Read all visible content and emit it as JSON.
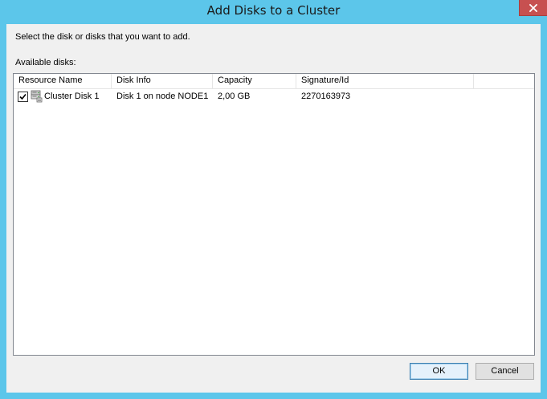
{
  "window": {
    "title": "Add Disks to a Cluster",
    "close_icon": "close-icon"
  },
  "dialog": {
    "instruction": "Select the disk or disks that you want to add.",
    "available_label": "Available disks:"
  },
  "table": {
    "columns": [
      "Resource Name",
      "Disk Info",
      "Capacity",
      "Signature/Id"
    ],
    "rows": [
      {
        "checked": true,
        "icon": "cluster-disk-icon",
        "resource_name": "Cluster Disk 1",
        "disk_info": "Disk 1 on node NODE1",
        "capacity": "2,00 GB",
        "signature": "2270163973"
      }
    ]
  },
  "buttons": {
    "ok": "OK",
    "cancel": "Cancel"
  },
  "colors": {
    "titlebar": "#5cc6ea",
    "close": "#c75050",
    "client": "#f0f0f0",
    "default_button": "#e5f1fb"
  }
}
